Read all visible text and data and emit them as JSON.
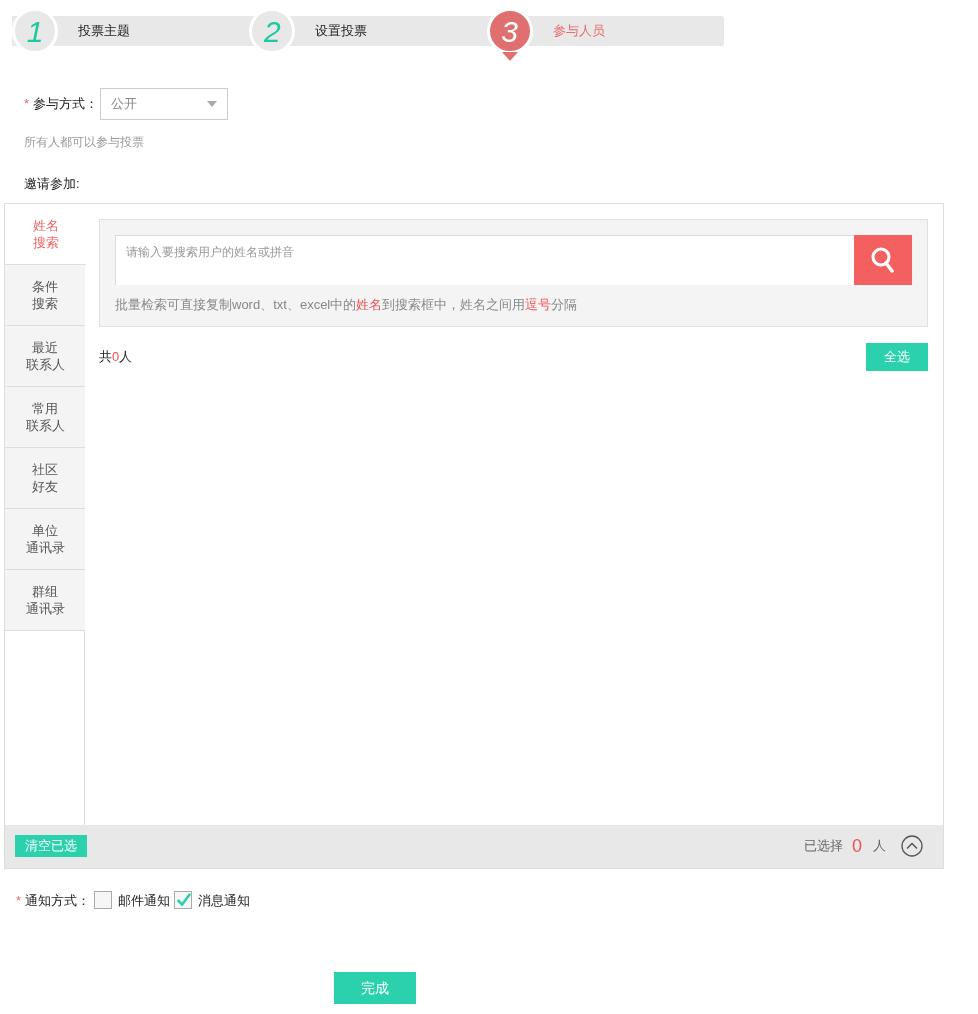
{
  "steps": [
    {
      "number": "1",
      "label": "投票主题",
      "selected": false
    },
    {
      "number": "2",
      "label": "设置投票",
      "selected": false
    },
    {
      "number": "3",
      "label": "参与人员",
      "selected": true
    }
  ],
  "participation": {
    "label": "参与方式：",
    "required_mark": "*",
    "value": "公开",
    "hint": "所有人都可以参与投票"
  },
  "invite_label": "邀请参加:",
  "tabs": [
    {
      "lines": [
        "姓名",
        "搜索"
      ],
      "selected": true
    },
    {
      "lines": [
        "条件",
        "搜索"
      ],
      "selected": false
    },
    {
      "lines": [
        "最近",
        "联系人"
      ],
      "selected": false
    },
    {
      "lines": [
        "常用",
        "联系人"
      ],
      "selected": false
    },
    {
      "lines": [
        "社区",
        "好友"
      ],
      "selected": false
    },
    {
      "lines": [
        "单位",
        "通讯录"
      ],
      "selected": false
    },
    {
      "lines": [
        "群组",
        "通讯录"
      ],
      "selected": false
    }
  ],
  "search": {
    "placeholder": "请输入要搜索用户的姓名或拼音"
  },
  "tip": [
    {
      "text": "批量检索可直接复制word、txt、excel中的",
      "highlight": false
    },
    {
      "text": "姓名",
      "highlight": true
    },
    {
      "text": "到搜索框中，姓名之间用",
      "highlight": false
    },
    {
      "text": "逗号",
      "highlight": true
    },
    {
      "text": "分隔",
      "highlight": false
    }
  ],
  "total": {
    "prefix": "共",
    "count": "0",
    "suffix": "人"
  },
  "select_all": "全选",
  "footer": {
    "clear": "清空已选",
    "selected_label": "已选择",
    "selected_count": "0",
    "unit": "人"
  },
  "notify": {
    "label": "通知方式：",
    "required_mark": "*",
    "options": [
      {
        "label": "邮件通知",
        "checked": false
      },
      {
        "label": "消息通知",
        "checked": true
      }
    ]
  },
  "submit": "完成"
}
